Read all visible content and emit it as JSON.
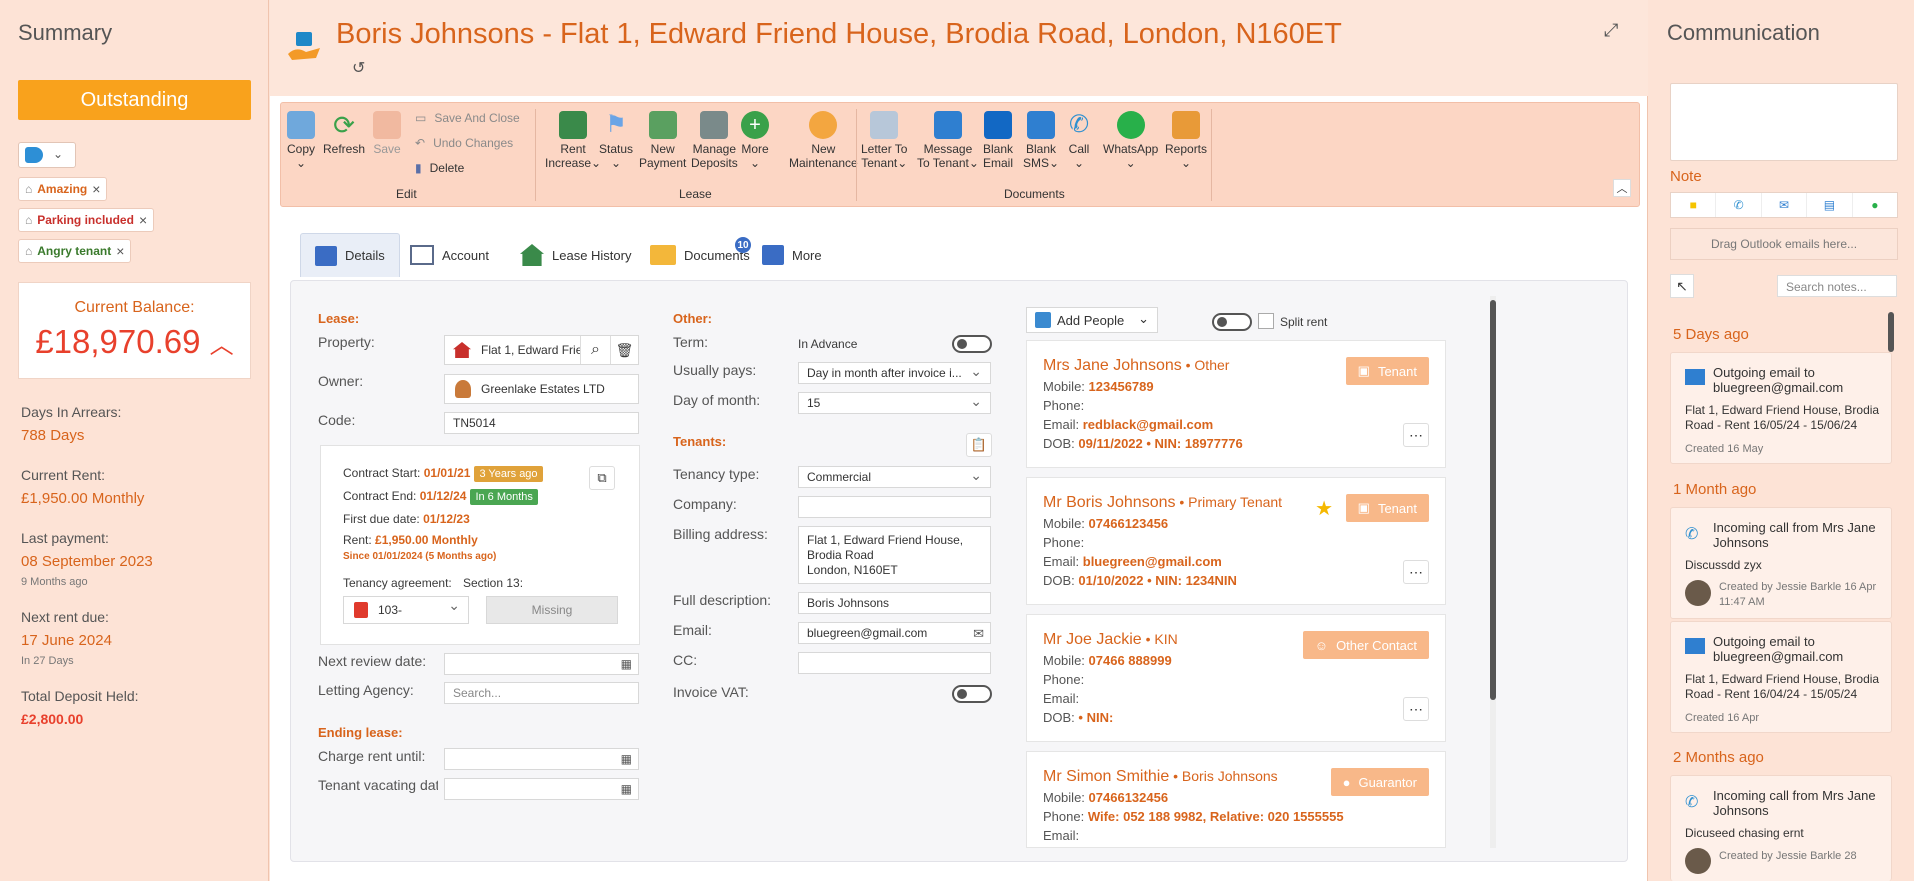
{
  "summary": {
    "title": "Summary",
    "status": "Outstanding",
    "tags": [
      {
        "label": "Amazing",
        "color": "#d8641c"
      },
      {
        "label": "Parking included",
        "color": "#c8302c"
      },
      {
        "label": "Angry tenant",
        "color": "#3a7a2c"
      }
    ],
    "balance_label": "Current Balance:",
    "balance_value": "£18,970.69",
    "days_arrears_label": "Days In Arrears:",
    "days_arrears": "788 Days",
    "current_rent_label": "Current Rent:",
    "current_rent": "£1,950.00 Monthly",
    "last_payment_label": "Last payment:",
    "last_payment": "08 September 2023",
    "last_payment_ago": "9 Months ago",
    "next_due_label": "Next rent due:",
    "next_due": "17 June 2024",
    "next_due_in": "In 27 Days",
    "deposit_label": "Total Deposit Held:",
    "deposit": "£2,800.00"
  },
  "header": {
    "title": "Boris Johnsons - Flat 1, Edward Friend House, Brodia Road, London, N160ET"
  },
  "ribbon": {
    "copy": "Copy",
    "refresh": "Refresh",
    "save": "Save",
    "save_close": "Save And Close",
    "undo": "Undo Changes",
    "delete": "Delete",
    "edit_group": "Edit",
    "rent_increase": "Rent Increase",
    "status": "Status",
    "new_payment": "New Payment",
    "manage_deposits": "Manage Deposits",
    "more": "More",
    "new_maintenance": "New Maintenance",
    "lease_group": "Lease",
    "letter": "Letter To Tenant",
    "message": "Message To Tenant",
    "blank_email": "Blank Email",
    "blank_sms": "Blank SMS",
    "call": "Call",
    "whatsapp": "WhatsApp",
    "reports": "Reports",
    "documents_group": "Documents"
  },
  "tabs": {
    "details": "Details",
    "account": "Account",
    "lease_history": "Lease History",
    "documents": "Documents",
    "documents_count": "10",
    "more": "More"
  },
  "lease": {
    "heading": "Lease:",
    "property_label": "Property:",
    "property": "Flat 1, Edward Frie",
    "owner_label": "Owner:",
    "owner": "Greenlake Estates LTD",
    "code_label": "Code:",
    "code": "TN5014",
    "contract_start_label": "Contract Start:",
    "contract_start": "01/01/21",
    "contract_start_badge": "3 Years ago",
    "contract_end_label": "Contract End:",
    "contract_end": "01/12/24",
    "contract_end_badge": "In 6 Months",
    "first_due_label": "First due date:",
    "first_due": "01/12/23",
    "rent_label": "Rent:",
    "rent": "£1,950.00  Monthly",
    "since": "Since 01/01/2024 (5 Months ago)",
    "agreement_label": "Tenancy agreement:",
    "agreement": "103-",
    "section13_label": "Section 13:",
    "section13": "Missing",
    "next_review_label": "Next review date:",
    "letting_label": "Letting Agency:",
    "letting_placeholder": "Search...",
    "ending_heading": "Ending lease:",
    "charge_until_label": "Charge rent until:",
    "vacating_label": "Tenant vacating dat"
  },
  "other": {
    "heading": "Other:",
    "term_label": "Term:",
    "term": "In Advance",
    "usually_pays_label": "Usually pays:",
    "usually_pays": "Day in month after invoice i...",
    "dom_label": "Day of month:",
    "dom": "15",
    "tenants_heading": "Tenants:",
    "tenancy_type_label": "Tenancy type:",
    "tenancy_type": "Commercial",
    "company_label": "Company:",
    "billing_label": "Billing address:",
    "billing_1": "Flat 1, Edward Friend House,",
    "billing_2": "Brodia Road",
    "billing_3": "London, N160ET",
    "full_desc_label": "Full description:",
    "full_desc": "Boris Johnsons",
    "email_label": "Email:",
    "email": "bluegreen@gmail.com",
    "cc_label": "CC:",
    "vat_label": "Invoice VAT:"
  },
  "people": {
    "add_label": "Add People",
    "split_label": "Split rent",
    "items": [
      {
        "name": "Mrs Jane Johnsons",
        "rel": " • Other",
        "role": "Tenant",
        "mobile_label": "Mobile:",
        "mobile": "123456789",
        "phone_label": "Phone:",
        "phone": "",
        "email_label": "Email:",
        "email": "redblack@gmail.com",
        "dob_label": "DOB:",
        "dob": "09/11/2022  • NIN: 18977776"
      },
      {
        "name": "Mr Boris Johnsons",
        "rel": " • Primary Tenant",
        "role": "Tenant",
        "mobile_label": "Mobile:",
        "mobile": "07466123456",
        "phone_label": "Phone:",
        "phone": "",
        "email_label": "Email:",
        "email": "bluegreen@gmail.com",
        "dob_label": "DOB:",
        "dob": "01/10/2022  • NIN: 1234NIN"
      },
      {
        "name": "Mr Joe Jackie",
        "rel": " • KIN",
        "role": "Other Contact",
        "mobile_label": "Mobile:",
        "mobile": "07466 888999",
        "phone_label": "Phone:",
        "phone": "",
        "email_label": "Email:",
        "email": "",
        "dob_label": "DOB:",
        "dob": "  • NIN:"
      },
      {
        "name": "Mr Simon Smithie",
        "rel": " • Boris Johnsons",
        "role": "Guarantor",
        "mobile_label": "Mobile:",
        "mobile": "07466132456",
        "phone_label": "Phone:",
        "phone": "Wife: 052 188 9982, Relative: 020 1555555",
        "email_label": "Email:",
        "email": "",
        "dob_label": "",
        "dob": ""
      }
    ]
  },
  "communication": {
    "title": "Communication",
    "note_label": "Note",
    "drag_label": "Drag Outlook emails here...",
    "search_placeholder": "Search notes...",
    "sec1": "5 Days ago",
    "sec2": "1 Month ago",
    "sec3": "2 Months ago",
    "c1_title": "Outgoing email to bluegreen@gmail.com",
    "c1_body": "Flat 1, Edward Friend House, Brodia Road - Rent 16/05/24 - 15/06/24",
    "c1_created": "Created 16 May",
    "c2_title": "Incoming call from Mrs Jane Johnsons",
    "c2_body": "Discussdd zyx",
    "c2_created": "Created by Jessie Barkle 16 Apr 11:47 AM",
    "c3_title": "Outgoing email to bluegreen@gmail.com",
    "c3_body": "Flat 1, Edward Friend House, Brodia Road - Rent 16/04/24 - 15/05/24",
    "c3_created": "Created 16 Apr",
    "c4_title": "Incoming call from Mrs Jane Johnsons",
    "c4_body": "Dicuseed chasing ernt",
    "c4_created": "Created by Jessie Barkle 28"
  }
}
